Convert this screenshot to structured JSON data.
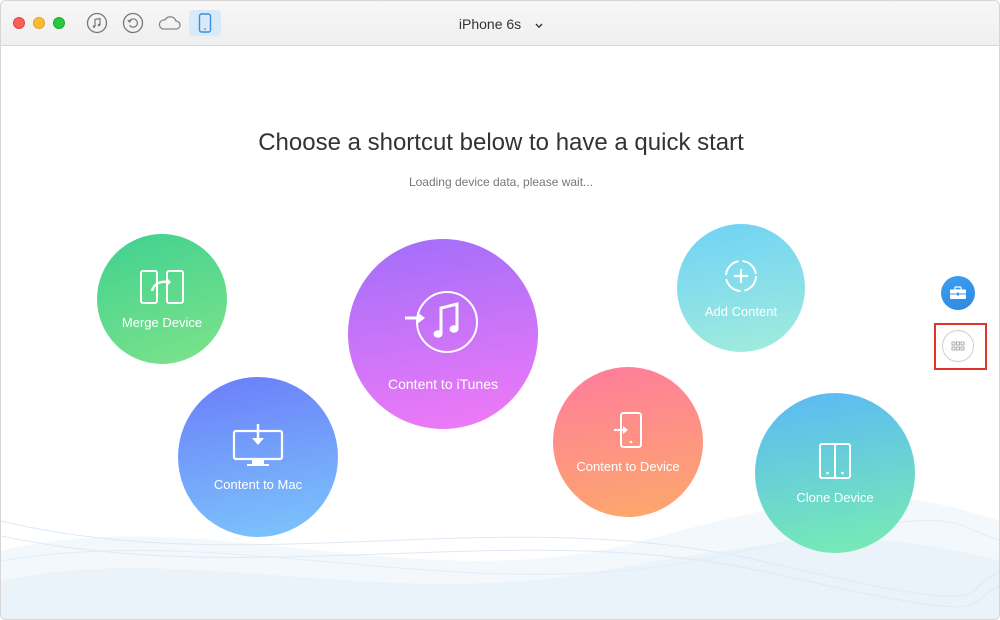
{
  "titlebar": {
    "device_name": "iPhone 6s"
  },
  "main": {
    "heading": "Choose a shortcut below to have a quick start",
    "status": "Loading device data, please wait..."
  },
  "shortcuts": {
    "merge_device": "Merge Device",
    "content_to_mac": "Content to Mac",
    "content_to_itunes": "Content to iTunes",
    "content_to_device": "Content to Device",
    "add_content": "Add Content",
    "clone_device": "Clone Device"
  },
  "icons": {
    "toolbar": [
      "music-icon",
      "restore-icon",
      "cloud-icon",
      "phone-icon"
    ],
    "side": [
      "toolbox-icon",
      "grid-icon"
    ]
  },
  "colors": {
    "highlight": "#e0332b",
    "selected_toolbar": "#d8eaf8"
  }
}
